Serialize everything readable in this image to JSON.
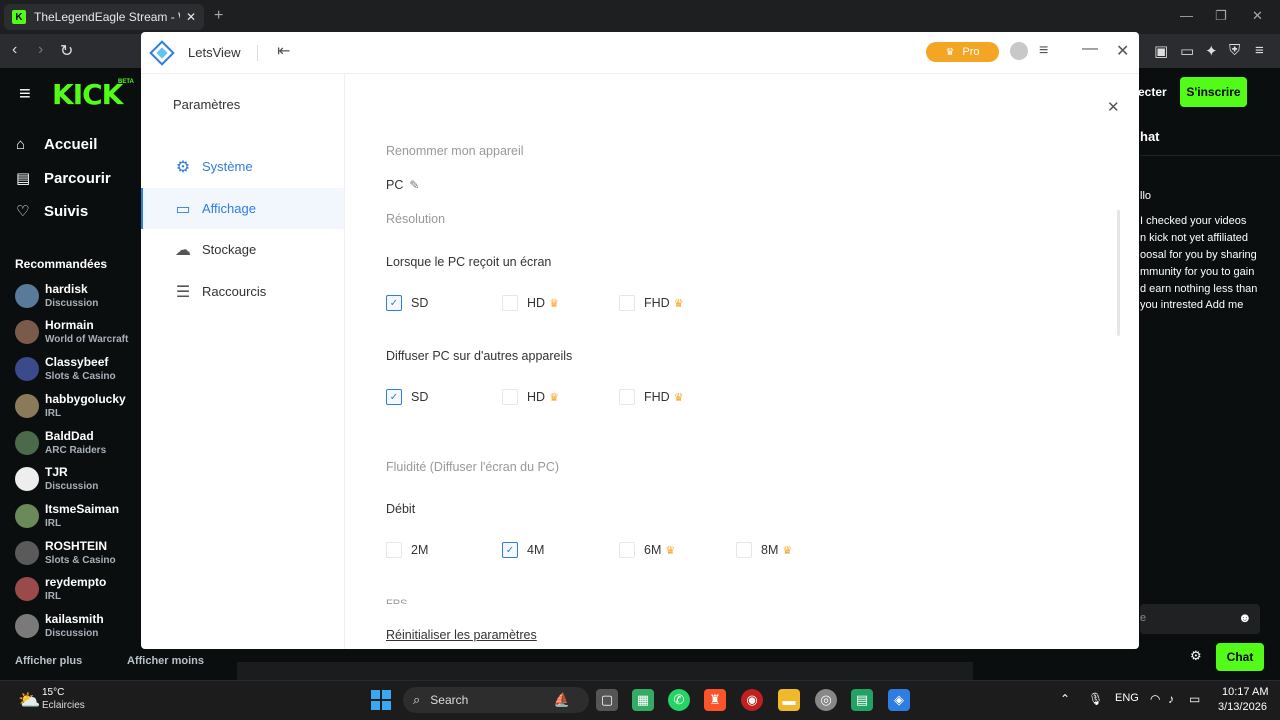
{
  "browser": {
    "tab_title": "TheLegendEagle Stream - Watch",
    "tab_close": "✕",
    "new_tab": "+",
    "win_min": "—",
    "win_max": "❐",
    "win_close": "✕",
    "favicon": "K"
  },
  "kick": {
    "logo": "KICK",
    "logo_badge": "BETA",
    "connect": "ecter",
    "signup": "S'inscrire",
    "nav": [
      {
        "label": "Accueil",
        "icon": "home-icon"
      },
      {
        "label": "Parcourir",
        "icon": "browse-icon"
      },
      {
        "label": "Suivis",
        "icon": "heart-icon"
      }
    ],
    "recommended_title": "Recommandées",
    "channels": [
      {
        "name": "hardisk",
        "category": "Discussion",
        "color": "#5a7a9a"
      },
      {
        "name": "Hormain",
        "category": "World of Warcraft",
        "color": "#7a5a4a"
      },
      {
        "name": "Classybeef",
        "category": "Slots & Casino",
        "color": "#3a4a8a"
      },
      {
        "name": "habbygolucky",
        "category": "IRL",
        "color": "#8a7a5a"
      },
      {
        "name": "BaldDad",
        "category": "ARC Raiders",
        "color": "#4a6a4a"
      },
      {
        "name": "TJR",
        "category": "Discussion",
        "color": "#eeeeee"
      },
      {
        "name": "ItsmeSaiman",
        "category": "IRL",
        "color": "#6a8a5a"
      },
      {
        "name": "ROSHTEIN",
        "category": "Slots & Casino",
        "color": "#5a5a5a"
      },
      {
        "name": "reydempto",
        "category": "IRL",
        "color": "#9a4a4a"
      },
      {
        "name": "kailasmith",
        "category": "Discussion",
        "color": "#7a7a7a"
      }
    ],
    "show_more": "Afficher plus",
    "show_less": "Afficher moins",
    "chat_header": "hat",
    "chat_lines": [
      "llo",
      "I checked your videos",
      "n kick not yet affiliated",
      "oosal for you by sharing",
      "mmunity for you to gain",
      "d earn nothing less than",
      "you intrested Add me"
    ],
    "chat_input_placeholder": "e",
    "chat_button": "Chat"
  },
  "letsview": {
    "app_name": "LetsView",
    "pro_label": "Pro",
    "settings_title": "Paramètres",
    "sidebar": [
      {
        "label": "Système",
        "icon": "gear-icon"
      },
      {
        "label": "Affichage",
        "icon": "display-icon"
      },
      {
        "label": "Stockage",
        "icon": "cloud-icon"
      },
      {
        "label": "Raccourcis",
        "icon": "sliders-icon"
      }
    ],
    "rename_title": "Renommer mon appareil",
    "device_name": "PC",
    "resolution_title": "Résolution",
    "receive_label": "Lorsque le PC reçoit un écran",
    "receive_options": [
      {
        "label": "SD",
        "checked": true,
        "pro": false
      },
      {
        "label": "HD",
        "checked": false,
        "pro": true
      },
      {
        "label": "FHD",
        "checked": false,
        "pro": true
      }
    ],
    "cast_label": "Diffuser PC sur d'autres appareils",
    "cast_options": [
      {
        "label": "SD",
        "checked": true,
        "pro": false
      },
      {
        "label": "HD",
        "checked": false,
        "pro": true
      },
      {
        "label": "FHD",
        "checked": false,
        "pro": true
      }
    ],
    "fluidity_title": "Fluidité (Diffuser l'écran du PC)",
    "bitrate_label": "Débit",
    "bitrate_options": [
      {
        "label": "2M",
        "checked": false,
        "pro": false
      },
      {
        "label": "4M",
        "checked": true,
        "pro": false
      },
      {
        "label": "6M",
        "checked": false,
        "pro": true
      },
      {
        "label": "8M",
        "checked": false,
        "pro": true
      }
    ],
    "fps_label_partial": "FPS",
    "reset_link": "Réinitialiser les paramètres"
  },
  "taskbar": {
    "temperature": "15°C",
    "weather": "Eclaircies",
    "search": "Search",
    "lang": "ENG",
    "time": "10:17 AM",
    "date": "3/13/2026"
  }
}
